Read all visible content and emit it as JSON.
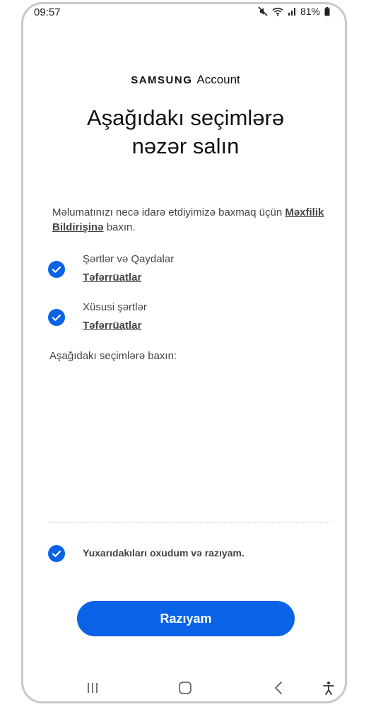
{
  "status_bar": {
    "time": "09:57",
    "battery_percent": "81%",
    "icons": [
      "mute-icon",
      "wifi-icon",
      "signal-icon",
      "battery-icon"
    ]
  },
  "brand": {
    "samsung": "SAMSUNG",
    "account": "Account"
  },
  "title_line1": "Aşağıdakı seçimlərə",
  "title_line2": "nəzər salın",
  "info": {
    "prefix": "Məlumatınızı necə idarə etdiyimizə baxmaq üçün ",
    "link": "Məxfilik Bildirişinə",
    "suffix": " baxın."
  },
  "terms": [
    {
      "label": "Şərtlər və Qaydalar",
      "details": "Təfərrüatlar",
      "checked": true
    },
    {
      "label": "Xüsusi şərtlər",
      "details": "Təfərrüatlar",
      "checked": true
    }
  ],
  "subheading": "Aşağıdakı seçimlərə baxın:",
  "agree_all": {
    "label": "Yuxarıdakıları oxudum və razıyam.",
    "checked": true
  },
  "primary_button": "Razıyam",
  "nav": [
    "recent-apps-icon",
    "home-icon",
    "back-icon",
    "accessibility-icon"
  ],
  "colors": {
    "accent": "#0a62e6",
    "text_secondary": "#444444",
    "frame": "#c9c9c9"
  }
}
